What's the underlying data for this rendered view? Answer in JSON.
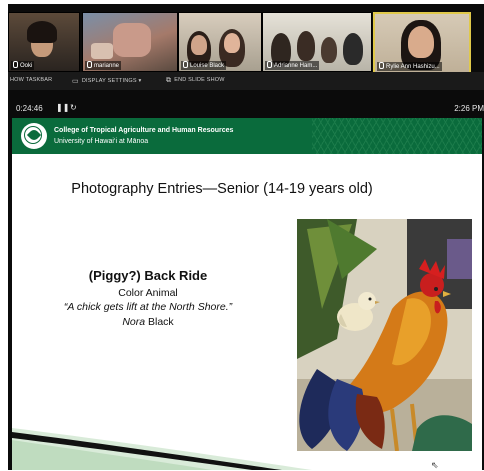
{
  "participants": [
    {
      "name": "Ooki"
    },
    {
      "name": "marianne"
    },
    {
      "name": "Louise Black"
    },
    {
      "name": "Adrianne Ham..."
    },
    {
      "name": "Rylie Ann Hashizu..."
    }
  ],
  "controls": {
    "show_taskbar": "HOW TASKBAR",
    "display_settings": "DISPLAY SETTINGS ▾",
    "end_slide_show": "END SLIDE SHOW"
  },
  "timer": {
    "elapsed": "0:24:46",
    "pause_icon": "❚❚",
    "restart_icon": "↻",
    "clock": "2:26 PM"
  },
  "slide": {
    "org_line1": "College of Tropical Agriculture and Human Resources",
    "org_line2": "University of Hawai‘i at Mānoa",
    "title": "Photography Entries—Senior (14-19 years old)",
    "entry_title": "(Piggy?) Back Ride",
    "entry_category": "Color Animal",
    "entry_quote": "“A chick gets lift at the North Shore.”",
    "entry_author_first": "Nora",
    "entry_author_last": " Black"
  },
  "colors": {
    "banner_green": "#0a6b3c",
    "active_speaker_border": "#e0c94a",
    "meeting_background": "#0b0b0b"
  },
  "icons": {
    "display_settings": "monitor-icon",
    "end_slide_show": "stop-presentation-icon",
    "pause": "pause-icon",
    "restart": "restart-icon"
  }
}
